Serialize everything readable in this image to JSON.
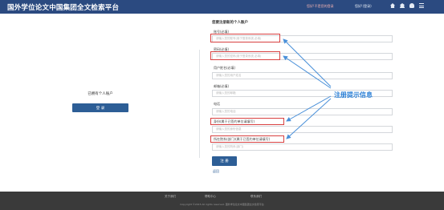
{
  "header": {
    "title": "国外学位论文中国集团全文检索平台",
    "notice": "您好!不是您的登录",
    "user": "您好!(登录)",
    "icons": [
      "home-icon",
      "library-icon",
      "user-icon",
      "menu-icon"
    ]
  },
  "left": {
    "title": "已拥有个人账户",
    "login_label": "登 录"
  },
  "form": {
    "heading": "您要注册新的个人账户",
    "fields": [
      {
        "label": "账号(必填)",
        "placeholder": "请输入您的账号(用于登录系统,必填)"
      },
      {
        "label": "密码(必填)",
        "placeholder": "请输入您的密码(用于登录系统,必填)"
      },
      {
        "label": "用户姓名(必填)",
        "placeholder": "请输入您的用户姓名"
      },
      {
        "label": "邮箱(必填)",
        "placeholder": "请输入您的邮箱"
      },
      {
        "label": "电话",
        "placeholder": "请输入您的电话"
      },
      {
        "label": "身份(属于已签约单位请填写)",
        "placeholder": "请输入您的身份信息"
      },
      {
        "label": "所在院系(部门)(属于已签约单位请填写)",
        "placeholder": "请输入您的院系(部门)"
      }
    ],
    "register_label": "注 册",
    "back_label": "返回"
  },
  "annotation": {
    "hint": "注册提示信息",
    "color": "#2a7fd6",
    "box_color": "#d84040"
  },
  "footer": {
    "links": [
      "关于我们",
      "帮助中心",
      "联系我们"
    ],
    "copyright": "Copyright ©2015 All rights reserved. 国外学位论文中国集团全文检索平台"
  }
}
